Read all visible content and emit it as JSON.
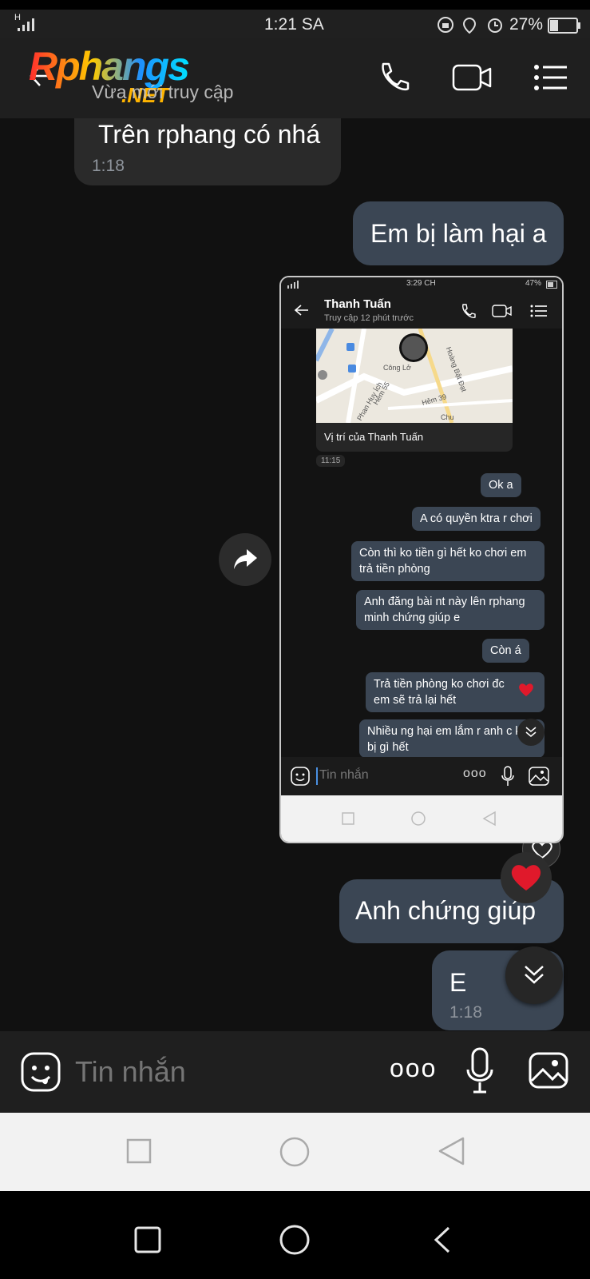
{
  "status_bar": {
    "signal": "H",
    "time": "1:21 SA",
    "battery": "27%"
  },
  "header": {
    "logo_main": "Rphangs",
    "logo_net": ".NET",
    "subtitle": "Vừa mới truy cập",
    "icons": [
      "back-arrow-icon",
      "phone-icon",
      "video-camera-icon",
      "menu-list-icon"
    ]
  },
  "messages": {
    "m1": {
      "text": "Trên rphang có nhá",
      "time": "1:18"
    },
    "m2": {
      "text": "Em bị làm hại a"
    },
    "m4": {
      "text": "Anh chứng giúp"
    },
    "m5": {
      "text": "E",
      "time": "1:18"
    }
  },
  "shared_screenshot": {
    "status_time": "3:29 CH",
    "battery": "47%",
    "contact_name": "Thanh Tuấn",
    "contact_status": "Truy cập 12 phút trước",
    "map_labels": [
      "Phan Huy Ích",
      "Công Lở",
      "Hoàng Bật Đạt",
      "Hẻm 55",
      "Hẻm 39",
      "Chu"
    ],
    "location_caption": "Vị trí của Thanh Tuấn",
    "location_time": "11:15",
    "messages": [
      "Ok a",
      "A có quyền ktra r chơi",
      "Còn thì ko tiền gì hết ko chơi em trả tiền phòng",
      "Anh đăng bài nt này lên rphang minh chứng giúp e",
      "Còn á",
      "Trả tiền phòng ko chơi đc em sẽ trả lại hết",
      "Nhiều ng hại em lắm r anh c ko bị gì hết"
    ],
    "input_placeholder": "Tin nhắn",
    "more_dots": "ooo"
  },
  "input": {
    "placeholder": "Tin nhắn",
    "more_dots": "ooo"
  },
  "colors": {
    "outgoing_bubble": "#3b4654",
    "incoming_bubble": "#2a2a2a",
    "background": "#111111",
    "heart": "#e0192b"
  }
}
